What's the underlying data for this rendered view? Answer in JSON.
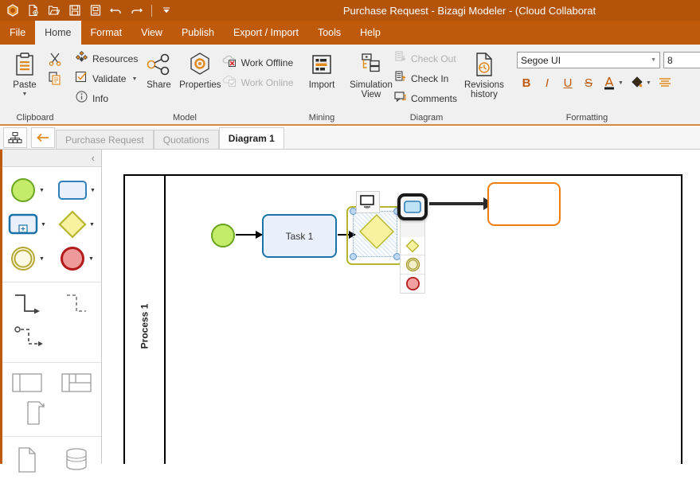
{
  "window": {
    "title": "Purchase Request - Bizagi Modeler - (Cloud Collaborat",
    "accent_color": "#c05a0b",
    "titlebar_color": "#b3540a"
  },
  "quick_access": [
    {
      "name": "app-logo-icon",
      "glyph": "bizagi"
    },
    {
      "name": "new-document-icon",
      "glyph": "new"
    },
    {
      "name": "open-document-icon",
      "glyph": "open"
    },
    {
      "name": "save-icon",
      "glyph": "save"
    },
    {
      "name": "save-as-icon",
      "glyph": "save-as"
    },
    {
      "name": "undo-icon",
      "glyph": "undo"
    },
    {
      "name": "redo-icon",
      "glyph": "redo"
    },
    {
      "name": "customize-qat-icon",
      "glyph": "chevron-down"
    }
  ],
  "menu_tabs": [
    {
      "label": "File",
      "active": false
    },
    {
      "label": "Home",
      "active": true
    },
    {
      "label": "Format",
      "active": false
    },
    {
      "label": "View",
      "active": false
    },
    {
      "label": "Publish",
      "active": false
    },
    {
      "label": "Export / Import",
      "active": false
    },
    {
      "label": "Tools",
      "active": false
    },
    {
      "label": "Help",
      "active": false
    }
  ],
  "ribbon": {
    "clipboard": {
      "group_label": "Clipboard",
      "paste_label": "Paste",
      "cut_tooltip": "Cut",
      "copy_tooltip": "Copy"
    },
    "model": {
      "group_label": "Model",
      "resources_label": "Resources",
      "validate_label": "Validate",
      "info_label": "Info",
      "share_label": "Share",
      "properties_label": "Properties",
      "work_offline_label": "Work Offline",
      "work_online_label": "Work Online"
    },
    "mining": {
      "group_label": "Mining",
      "import_label": "Import"
    },
    "diagram": {
      "group_label": "Diagram",
      "simulation_view_label": "Simulation\nView",
      "simulation_view_line1": "Simulation",
      "simulation_view_line2": "View",
      "check_out_label": "Check Out",
      "check_in_label": "Check In",
      "comments_label": "Comments",
      "revisions_line1": "Revisions",
      "revisions_line2": "history"
    },
    "formatting": {
      "group_label": "Formatting",
      "font_family_value": "Segoe UI",
      "font_size_value": "8",
      "bold_label": "B",
      "italic_label": "I",
      "underline_label": "U",
      "strikethrough_label": "S",
      "font_color_label": "A",
      "fill_color_label": "fill",
      "align_label": "align"
    }
  },
  "doc_tabs": {
    "diagram_view_button": "diagram-view",
    "back_button": "back",
    "tabs": [
      {
        "label": "Purchase Request",
        "active": false
      },
      {
        "label": "Quotations",
        "active": false
      },
      {
        "label": "Diagram 1",
        "active": true
      }
    ]
  },
  "palette": {
    "collapse_label": "‹",
    "sections": [
      {
        "name": "events-activities",
        "rows": [
          [
            {
              "name": "start-event-shape",
              "has_caret": true
            },
            {
              "name": "task-shape",
              "has_caret": true
            }
          ],
          [
            {
              "name": "subprocess-shape",
              "has_caret": true
            },
            {
              "name": "gateway-shape",
              "has_caret": true
            }
          ],
          [
            {
              "name": "intermediate-event-shape",
              "has_caret": true
            },
            {
              "name": "end-event-shape",
              "has_caret": true
            }
          ]
        ]
      },
      {
        "name": "connectors",
        "rows": [
          [
            {
              "name": "sequence-flow-connector",
              "has_caret": false
            },
            {
              "name": "message-flow-connector",
              "has_caret": false
            }
          ],
          [
            {
              "name": "association-connector",
              "has_caret": false
            }
          ]
        ]
      },
      {
        "name": "containers",
        "rows": [
          [
            {
              "name": "pool-shape",
              "has_caret": false
            },
            {
              "name": "lane-shape",
              "has_caret": false
            }
          ],
          [
            {
              "name": "annotation-shape",
              "has_caret": false
            }
          ]
        ]
      },
      {
        "name": "artifacts",
        "rows": [
          [
            {
              "name": "data-object-shape",
              "has_caret": false
            },
            {
              "name": "data-store-shape",
              "has_caret": false
            }
          ]
        ]
      }
    ]
  },
  "canvas": {
    "pool": {
      "lane_label": "Process 1"
    },
    "shapes": {
      "start_event": {
        "name": "start-event",
        "fill": "#c5eb6b",
        "stroke": "#6aa521"
      },
      "task1": {
        "label": "Task 1",
        "fill": "#eaf0fb",
        "stroke": "#1b72a8"
      },
      "gateway": {
        "label": "",
        "fill": "#f7f2a0",
        "stroke": "#b5b52e",
        "selected": true
      },
      "ghost_task": {
        "label": "",
        "stroke": "#f07d10"
      }
    },
    "shape_picker": {
      "name": "quick-shape-picker",
      "selected_index": 0,
      "options": [
        {
          "name": "picker-task-option",
          "shape": "task",
          "selected": true
        },
        {
          "name": "picker-gateway-option",
          "shape": "gateway",
          "selected": false
        },
        {
          "name": "picker-intermediate-event-option",
          "shape": "intermediate-event",
          "selected": false
        },
        {
          "name": "picker-end-event-option",
          "shape": "end-event",
          "selected": false
        }
      ]
    }
  }
}
